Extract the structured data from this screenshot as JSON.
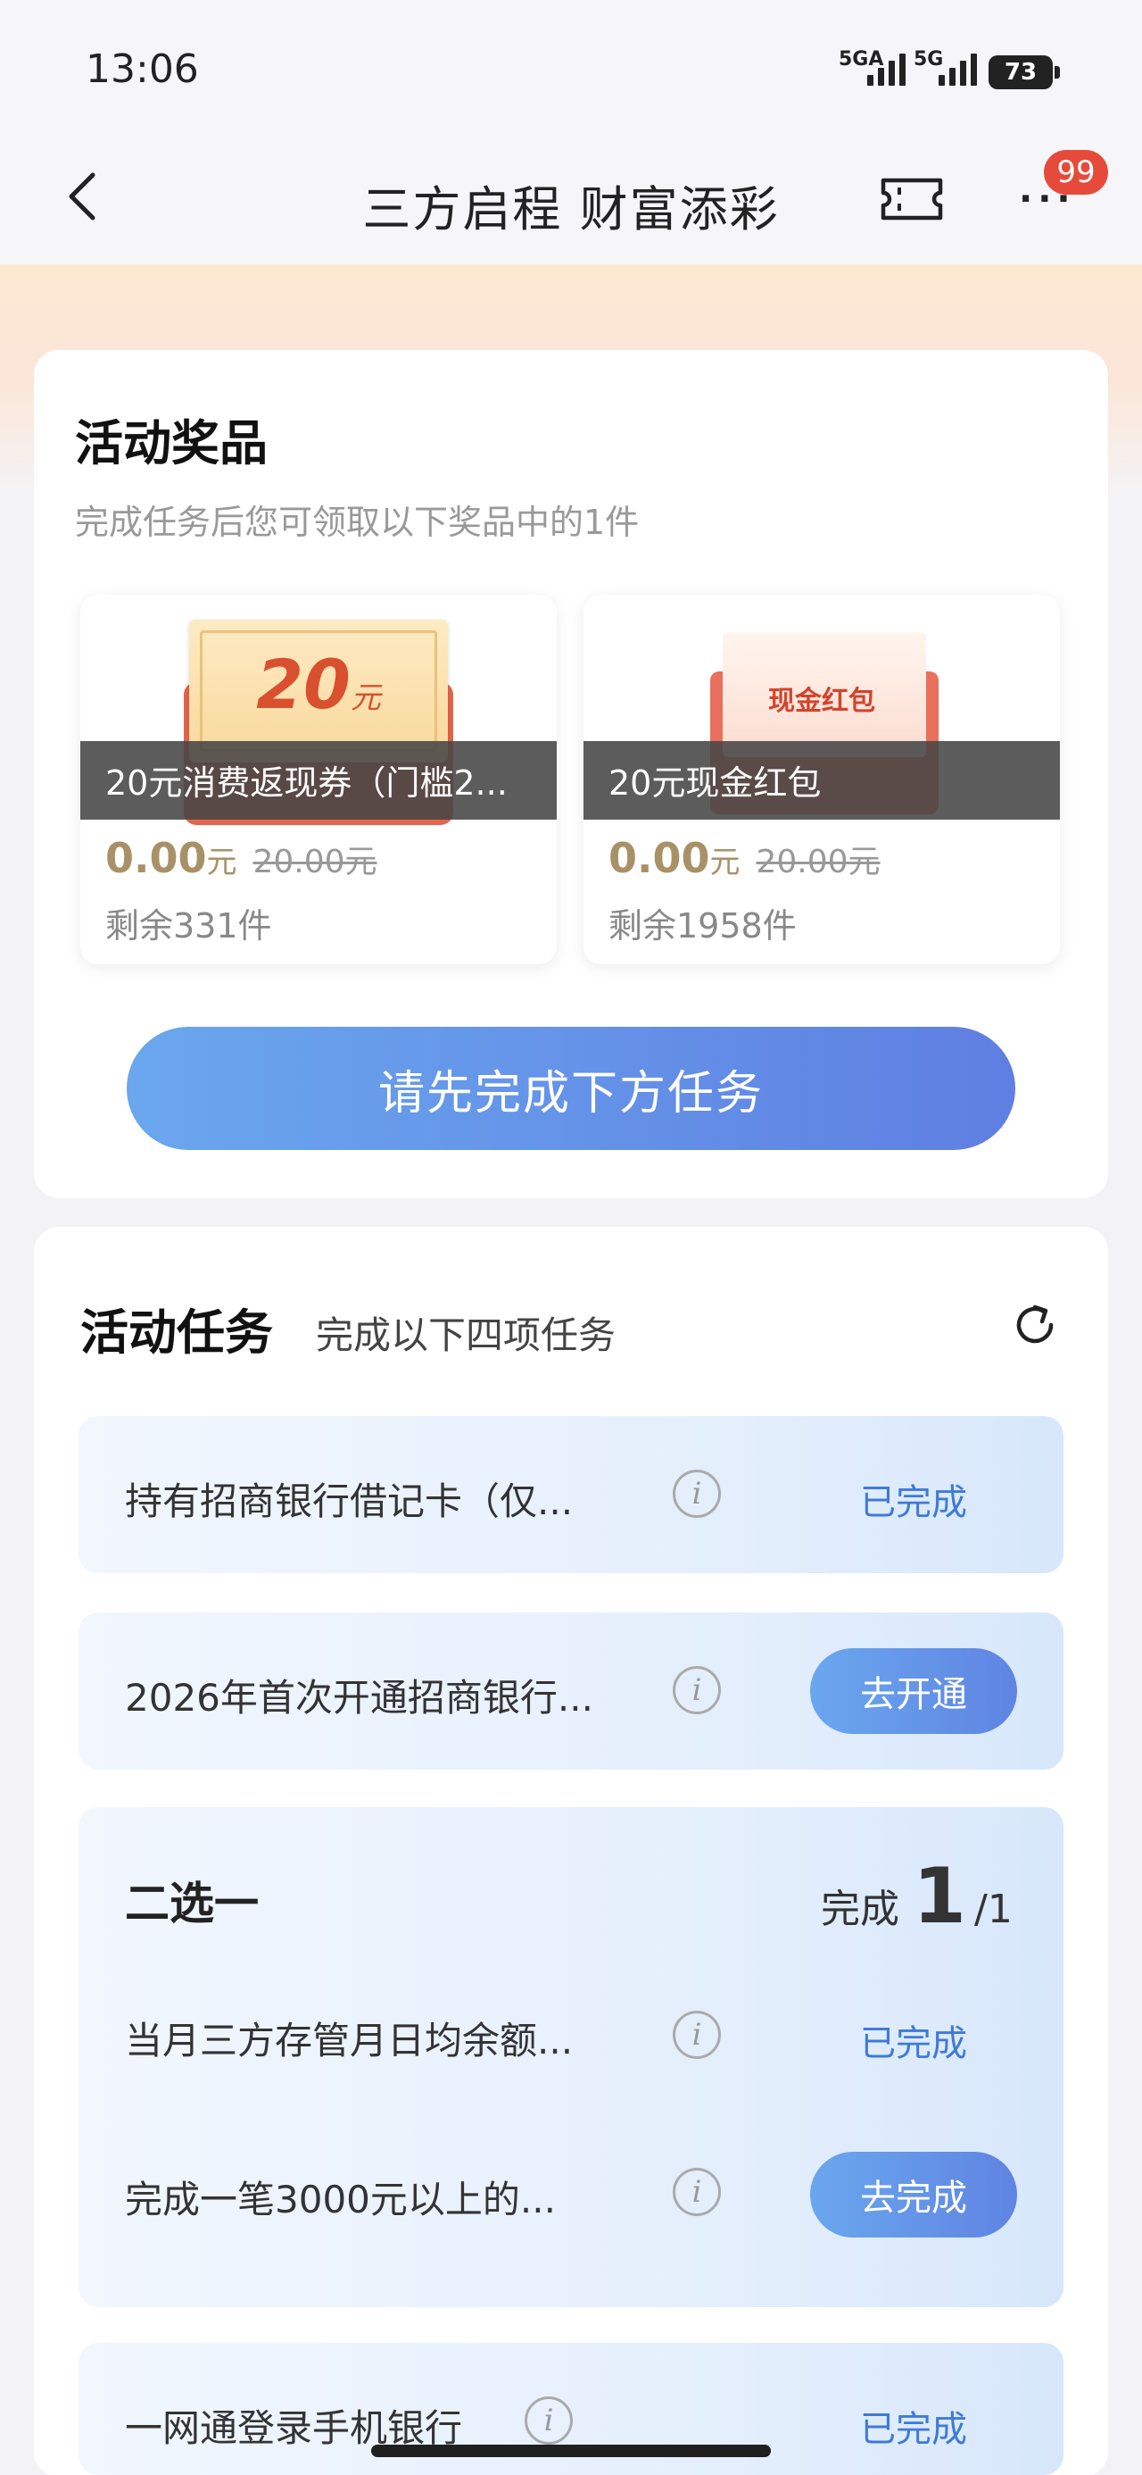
{
  "status": {
    "time": "13:06",
    "net1": "5GA",
    "net2": "5G",
    "battery": "73"
  },
  "nav": {
    "title": "三方启程 财富添彩",
    "badge": "99"
  },
  "prizes": {
    "title": "活动奖品",
    "subtitle": "完成任务后您可领取以下奖品中的1件",
    "items": [
      {
        "img_text": "20",
        "img_unit": "元",
        "label": "20元消费返现券（门槛2...",
        "price": "0.00",
        "price_unit": "元",
        "orig": "20.00元",
        "remain": "剩余331件"
      },
      {
        "img_text": "现金红包",
        "label": "20元现金红包",
        "price": "0.00",
        "price_unit": "元",
        "orig": "20.00元",
        "remain": "剩余1958件"
      }
    ],
    "button": "请先完成下方任务"
  },
  "tasks": {
    "title": "活动任务",
    "subtitle": "完成以下四项任务",
    "items": [
      {
        "text": "持有招商银行借记卡（仅...",
        "status": "已完成"
      },
      {
        "text": "2026年首次开通招商银行...",
        "action": "去开通"
      }
    ],
    "group": {
      "title": "二选一",
      "progress_label": "完成",
      "progress_done": "1",
      "progress_total": "1",
      "items": [
        {
          "text": "当月三方存管月日均余额...",
          "status": "已完成"
        },
        {
          "text": "完成一笔3000元以上的...",
          "action": "去完成"
        }
      ]
    },
    "last": {
      "text": "一网通登录手机银行",
      "status": "已完成"
    }
  }
}
